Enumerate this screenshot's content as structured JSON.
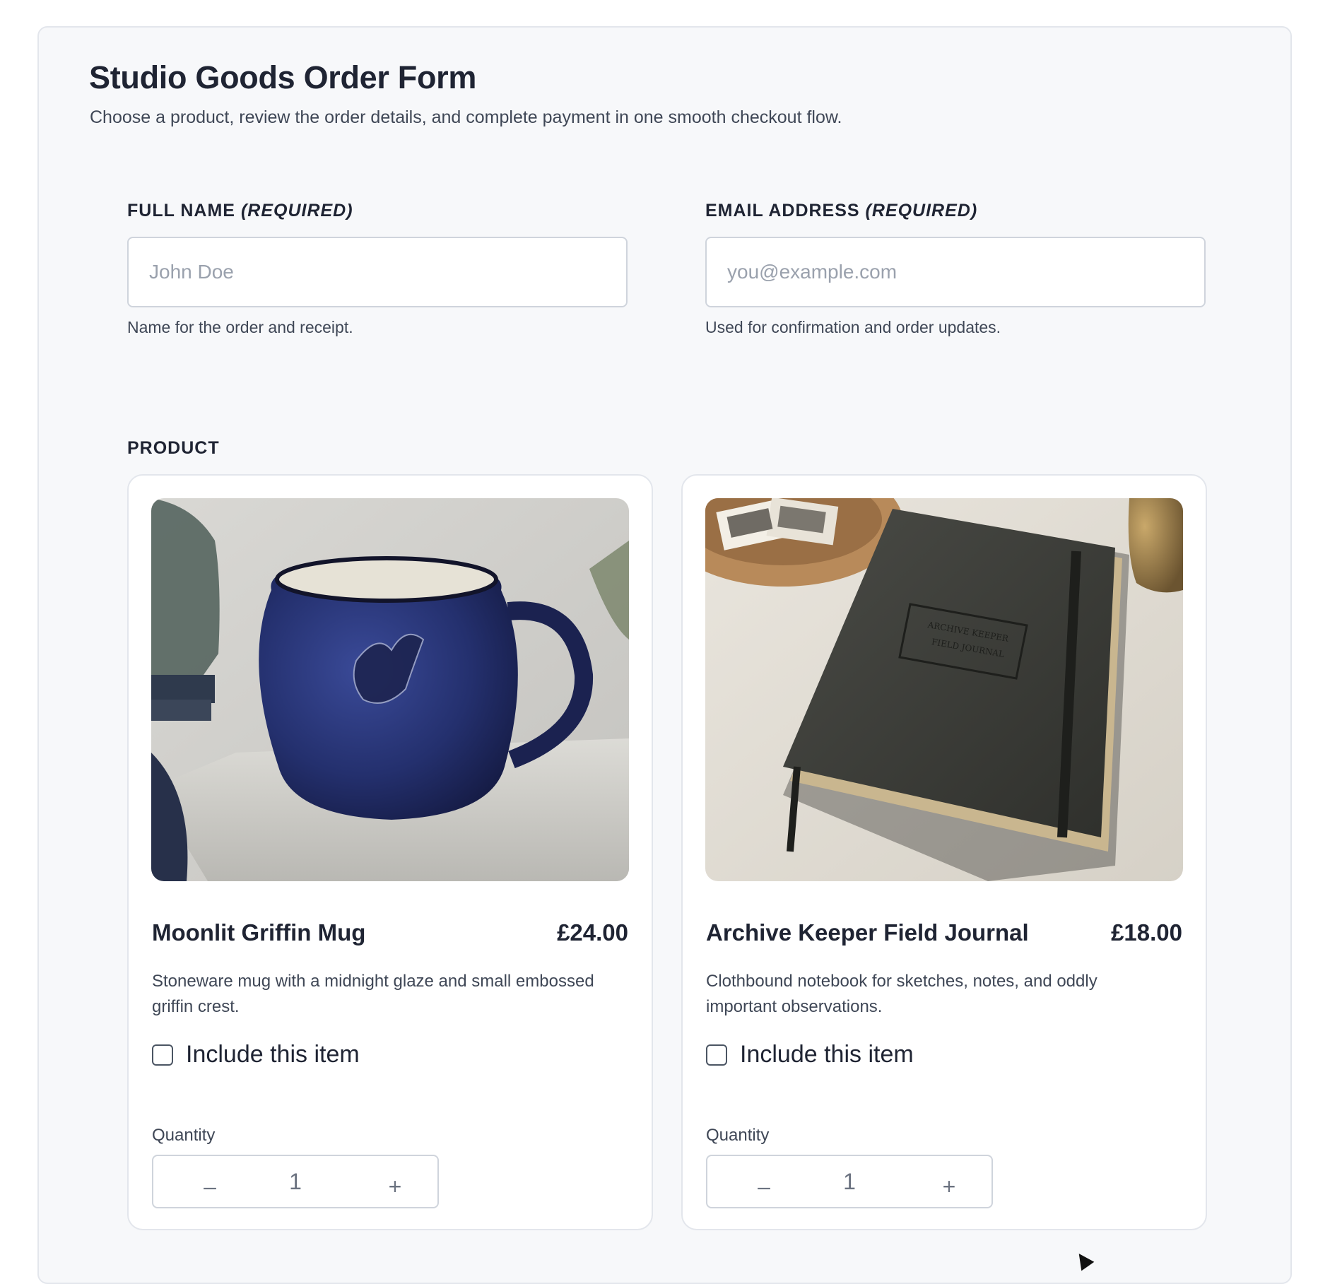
{
  "form": {
    "title": "Studio Goods Order Form",
    "subtitle": "Choose a product, review the order details, and complete payment in one smooth checkout flow."
  },
  "fields": {
    "full_name": {
      "label": "Full Name",
      "required": "(Required)",
      "placeholder": "John Doe",
      "value": "",
      "help": "Name for the order and receipt."
    },
    "email": {
      "label": "Email Address",
      "required": "(Required)",
      "placeholder": "you@example.com",
      "value": "",
      "help": "Used for confirmation and order updates."
    }
  },
  "product_section": {
    "label": "Product",
    "products": [
      {
        "name": "Moonlit Griffin Mug",
        "price": "£24.00",
        "description": "Stoneware mug with a midnight glaze and small embossed griffin crest.",
        "include_label": "Include this item",
        "included": false,
        "quantity_label": "Quantity",
        "quantity": "1",
        "minus": "–",
        "plus": "+",
        "image_icon": "mug-photo"
      },
      {
        "name": "Archive Keeper Field Journal",
        "price": "£18.00",
        "description": "Clothbound notebook for sketches, notes, and oddly important observations.",
        "include_label": "Include this item",
        "included": false,
        "quantity_label": "Quantity",
        "quantity": "1",
        "minus": "–",
        "plus": "+",
        "image_icon": "journal-photo",
        "image_text_line1": "ARCHIVE KEEPER",
        "image_text_line2": "FIELD JOURNAL"
      }
    ]
  },
  "colors": {
    "page_bg": "#f7f8fa",
    "text_primary": "#1f2433",
    "text_secondary": "#3f4756",
    "border": "#cfd4dc",
    "mug_glaze": "#24306e",
    "journal_cover": "#3d3e3a"
  }
}
